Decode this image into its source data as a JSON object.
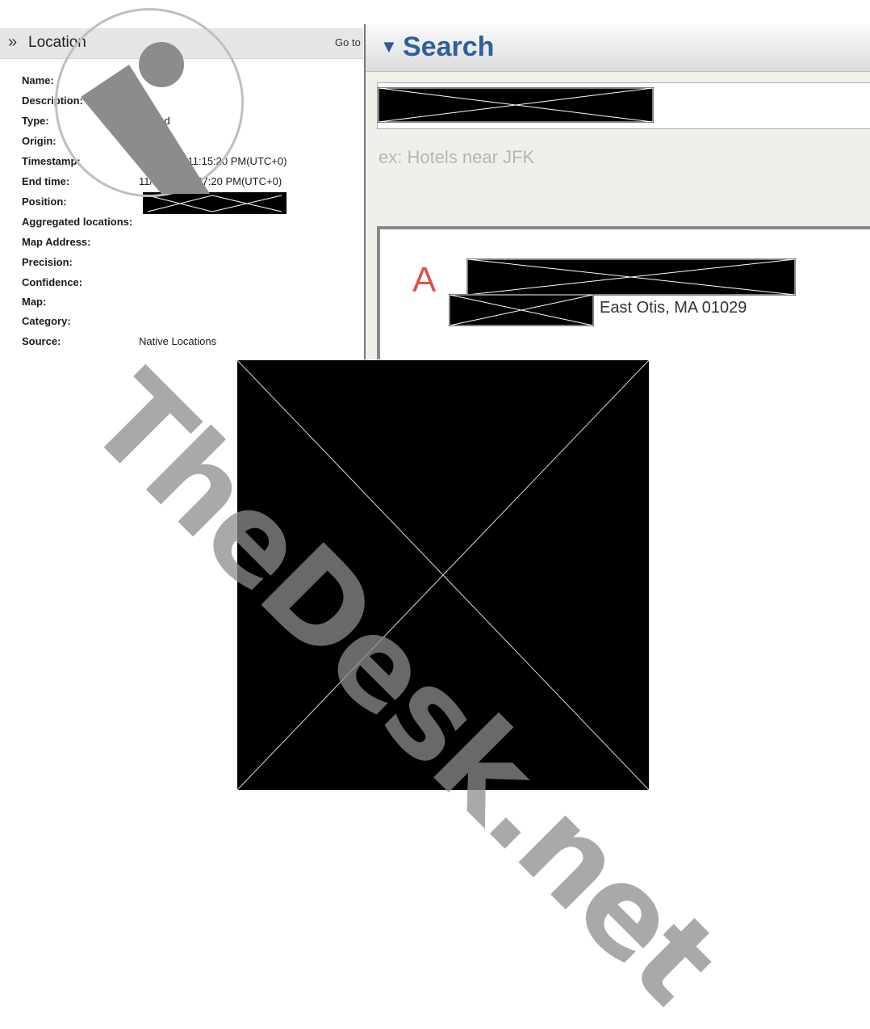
{
  "location_panel": {
    "title": "Location",
    "go_to": "Go to",
    "properties": [
      {
        "label": "Name:",
        "value": ""
      },
      {
        "label": "Description:",
        "value": ""
      },
      {
        "label": "Type:",
        "value": "Visited"
      },
      {
        "label": "Origin:",
        "value": ""
      },
      {
        "label": "Timestamp:",
        "value": "11/6/2021 11:15:20 PM(UTC+0)"
      },
      {
        "label": "End time:",
        "value": "11/7/2021 2:57:20 PM(UTC+0)"
      },
      {
        "label": "Position:",
        "value": ""
      },
      {
        "label": "Aggregated locations:",
        "value": ""
      },
      {
        "label": "Map Address:",
        "value": ""
      },
      {
        "label": "Precision:",
        "value": ""
      },
      {
        "label": "Confidence:",
        "value": ""
      },
      {
        "label": "Map:",
        "value": ""
      },
      {
        "label": "Category:",
        "value": ""
      },
      {
        "label": "Source:",
        "value": "Native Locations"
      }
    ]
  },
  "search_panel": {
    "title": "Search",
    "hint": "ex: Hotels near JFK",
    "result": {
      "marker": "A",
      "address_suffix": "East Otis, MA 01029"
    }
  },
  "watermark": {
    "text": "TheDesk.net"
  },
  "icons": {
    "header_expand": "double-chevron-right-icon",
    "search_collapse": "triangle-down-icon"
  },
  "colors": {
    "search_title": "#2e5f9e",
    "result_marker": "#d9534f",
    "redaction": "#000000"
  }
}
